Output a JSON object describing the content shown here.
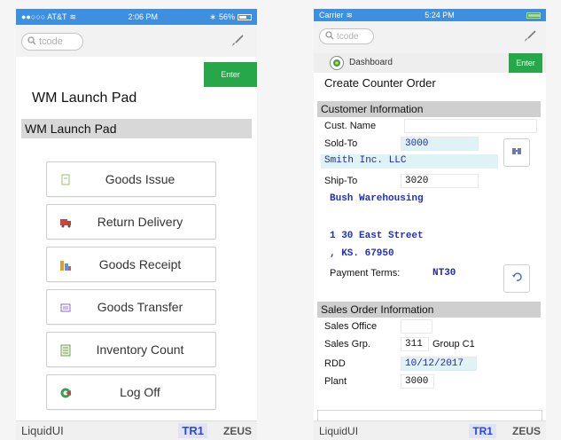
{
  "left_phone": {
    "status": {
      "carrier": "●●○○○ AT&T",
      "time": "2:06 PM",
      "battery": "56%",
      "battery_level": 0.56
    },
    "search_placeholder": "tcode",
    "enter_label": "Enter",
    "page_title": "WM Launch Pad",
    "section_title": "WM Launch Pad",
    "menu": [
      {
        "label": "Goods Issue",
        "icon": "document-icon",
        "color": "#9bbf6a"
      },
      {
        "label": "Return Delivery",
        "icon": "truck-icon",
        "color": "#d64040"
      },
      {
        "label": "Goods Receipt",
        "icon": "boxes-icon",
        "color": "#d8a030"
      },
      {
        "label": "Goods Transfer",
        "icon": "transfer-icon",
        "color": "#8a6ad0"
      },
      {
        "label": "Inventory Count",
        "icon": "list-icon",
        "color": "#7aa060"
      },
      {
        "label": "Log Off",
        "icon": "logoff-icon",
        "color": "#3aa050"
      }
    ],
    "footer": {
      "brand": "LiquidUI",
      "system": "TR1",
      "server": "ZEUS"
    }
  },
  "right_phone": {
    "status": {
      "carrier": "Carrier",
      "time": "5:24 PM",
      "battery_level": 1.0
    },
    "search_placeholder": "tcode",
    "dashboard_label": "Dashboard",
    "enter_label": "Enter",
    "page_title": "Create Counter Order",
    "customer_section": "Customer Information",
    "cust_name_label": "Cust. Name",
    "cust_name_value": "",
    "sold_to_label": "Sold-To",
    "sold_to_value": "3000",
    "sold_to_name": "Smith Inc. LLC",
    "ship_to_label": "Ship-To",
    "ship_to_value": "3020",
    "ship_to_name": "Bush Warehousing",
    "address_line1": "1 30 East Street",
    "address_line2": ", KS. 67950",
    "payment_terms_label": "Payment Terms:",
    "payment_terms_value": "NT30",
    "sales_section": "Sales Order Information",
    "sales_office_label": "Sales Office",
    "sales_office_value": "",
    "sales_grp_label": "Sales Grp.",
    "sales_grp_value": "311",
    "sales_grp_desc": "Group C1",
    "rdd_label": "RDD",
    "rdd_value": "10/12/2017",
    "plant_label": "Plant",
    "plant_value": "3000",
    "footer": {
      "brand": "LiquidUI",
      "system": "TR1",
      "server": "ZEUS"
    }
  },
  "colors": {
    "status_bar": "#3f8fdf",
    "enter": "#27a74a",
    "system_badge": "#2b48d8"
  }
}
